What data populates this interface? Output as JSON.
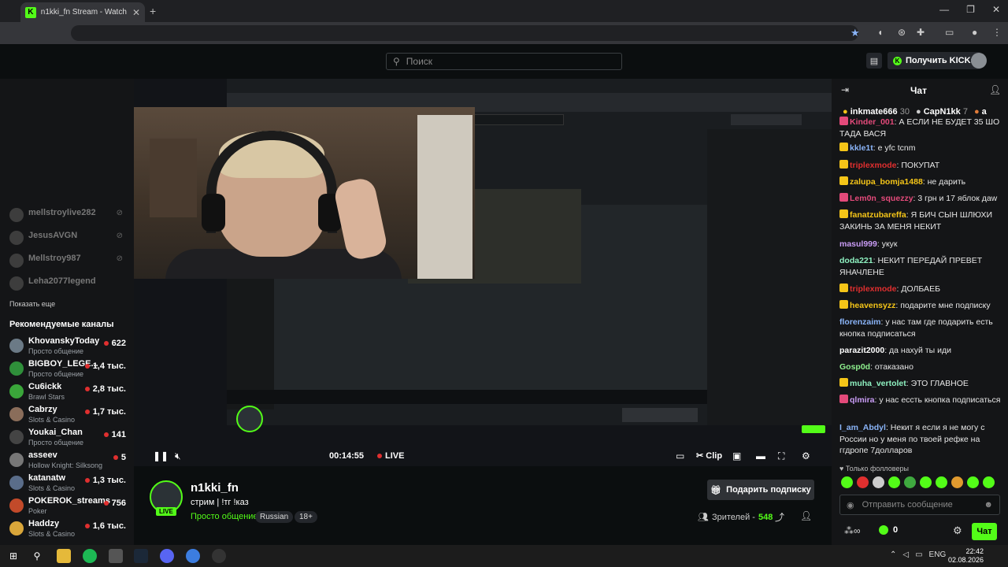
{
  "browser": {
    "tab_title": "n1kki_fn Stream - Watch Live on Kick",
    "tab_favicon": "K",
    "close_tab": "✕",
    "new_tab": "+",
    "window_controls": [
      "—",
      "❐",
      "✕"
    ]
  },
  "header": {
    "search_placeholder": "Поиск",
    "kicks_button": "Получить KICKs",
    "accent": "#53fc18"
  },
  "sidebar": {
    "followed_offline": [
      {
        "name": "mellstroylive282"
      },
      {
        "name": "JesusAVGN"
      },
      {
        "name": "Mellstroy987"
      },
      {
        "name": "Leha2077legend"
      }
    ],
    "show_more": "Показать еще",
    "recommended_title": "Рекомендуемые каналы",
    "recommended": [
      {
        "name": "KhovanskyToday",
        "category": "Просто общение",
        "viewers": "622",
        "color": "#6b7a86"
      },
      {
        "name": "BIGBOY_LEGE...",
        "category": "Просто общение",
        "viewers": "1,4 тыс.",
        "color": "#2f8f3a"
      },
      {
        "name": "Cu6ickk",
        "category": "Brawl Stars",
        "viewers": "2,8 тыс.",
        "color": "#3aa63a"
      },
      {
        "name": "Cabrzy",
        "category": "Slots & Casino",
        "viewers": "1,7 тыс.",
        "color": "#8a6d5a"
      },
      {
        "name": "Youkai_Chan",
        "category": "Просто общение",
        "viewers": "141",
        "color": "#444"
      },
      {
        "name": "asseev",
        "category": "Hollow Knight: Silksong",
        "viewers": "5",
        "color": "#777"
      },
      {
        "name": "katanatw",
        "category": "Slots & Casino",
        "viewers": "1,3 тыс.",
        "color": "#5a6d8a"
      },
      {
        "name": "POKEROK_streams",
        "category": "Poker",
        "viewers": "756",
        "color": "#c24a2a"
      },
      {
        "name": "Haddzy",
        "category": "Slots & Casino",
        "viewers": "1,6 тыс.",
        "color": "#d9a63a"
      }
    ]
  },
  "player": {
    "time": "00:14:55",
    "live_label": "LIVE",
    "clip_label": "Clip"
  },
  "channel": {
    "name": "n1kki_fn",
    "title": "стрим | !тг !каз",
    "category": "Просто общение",
    "tags": [
      "Russian",
      "18+"
    ],
    "gift_button": "Подарить подписку",
    "viewers_label": "Зрителей -",
    "viewers_count": "548",
    "live_badge": "LIVE"
  },
  "chat": {
    "title": "Чат",
    "pinned": [
      {
        "name": "inkmate666",
        "count": "30"
      },
      {
        "name": "CapN1kk",
        "count": "7"
      },
      {
        "name": "3",
        "count": "а"
      }
    ],
    "messages": [
      {
        "user": "Kinder_001",
        "color": "#e34a7a",
        "badge": "#e34a7a",
        "text": ": А ЕСЛИ НЕ БУДЕТ 35 ШО ТАДА ВАСЯ"
      },
      {
        "user": "kkle1t",
        "color": "#8ab4f8",
        "badge": "#f5c518",
        "text": ": е уfc tcnm"
      },
      {
        "user": "triplexmode",
        "color": "#e02f2f",
        "badge": "#f5c518",
        "text": ": ПОКУПАТ"
      },
      {
        "user": "zalupa_bomja1488",
        "color": "#f5c518",
        "badge": "#f5c518",
        "text": ": не дарить"
      },
      {
        "user": "Lem0n_squezzy",
        "color": "#e34a7a",
        "badge": "#e34a7a",
        "text": ": 3 грн и 17 яблок дaw"
      },
      {
        "user": "fanatzubareffa",
        "color": "#f5c518",
        "badge": "#f5c518",
        "text": ": Я БИЧ СЫН ШЛЮХИ ЗАКИНЬ ЗА МЕНЯ НЕКИТ"
      },
      {
        "user": "masul999",
        "color": "#c99cf5",
        "badge": "",
        "text": ": укук"
      },
      {
        "user": "doda221",
        "color": "#8ef0c0",
        "badge": "",
        "text": ": НЕКИТ ПЕРЕДАЙ ПРЕВЕТ ЯНАЧЛЕНЕ"
      },
      {
        "user": "triplexmode",
        "color": "#e02f2f",
        "badge": "#f5c518",
        "text": ": ДОЛБАЕБ"
      },
      {
        "user": "heavensyzz",
        "color": "#f5c518",
        "badge": "#f5c518",
        "text": ": подарите мне подписку"
      },
      {
        "user": "florenzaim",
        "color": "#8ab4f8",
        "badge": "",
        "text": ": у нас там где подарить есть кнопка подписаться"
      },
      {
        "user": "parazit2000",
        "color": "#ffffff",
        "badge": "",
        "text": ": да нахуй ты иди"
      },
      {
        "user": "Gosp0d",
        "color": "#8ef08e",
        "badge": "",
        "text": ": отаказано"
      },
      {
        "user": "muha_vertolet",
        "color": "#8ef0c0",
        "badge": "#f5c518",
        "text": ": ЭТО ГЛАВНОЕ"
      },
      {
        "user": "qlmira",
        "color": "#c99cf5",
        "badge": "#e34a7a",
        "text": ": у нас ессть кнопка подписаться"
      },
      {
        "user": "I_am_Abdyl",
        "color": "#8ab4f8",
        "badge": "",
        "text": ": Некит я если я не могу с России но у меня по твоей рефке на ггдропе 7долларов"
      }
    ],
    "followers_only": "Только фолловеры",
    "input_placeholder": "Отправить сообщение",
    "kicks_balance": "0",
    "send_button": "Чат"
  },
  "taskbar": {
    "lang": "ENG",
    "time": "22:42",
    "date": "02.08.2026"
  }
}
